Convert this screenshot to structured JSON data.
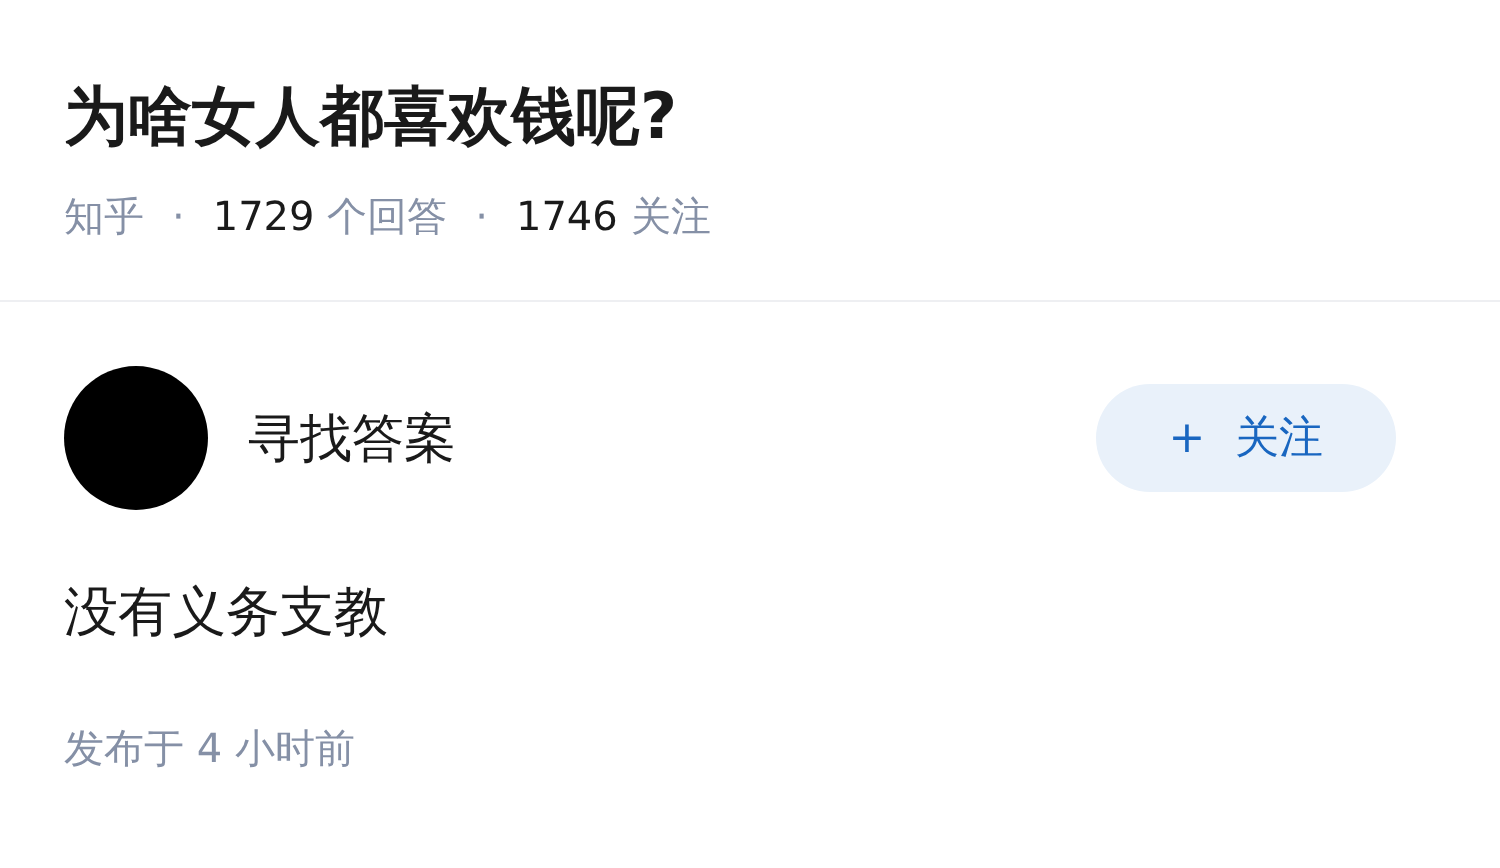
{
  "question": {
    "title": "为啥女人都喜欢钱呢?",
    "meta": [
      {
        "kind": "source",
        "text": "知乎"
      },
      {
        "kind": "separator",
        "text": "·"
      },
      {
        "kind": "count",
        "number": "1729",
        "unit": "个回答"
      },
      {
        "kind": "separator",
        "text": "·"
      },
      {
        "kind": "count",
        "number": "1746",
        "unit": "关注"
      }
    ]
  },
  "answer": {
    "author": "寻找答案",
    "follow_button": "+ 关注",
    "content": "没有义务支教",
    "time": "发布于 4 小时前"
  }
}
